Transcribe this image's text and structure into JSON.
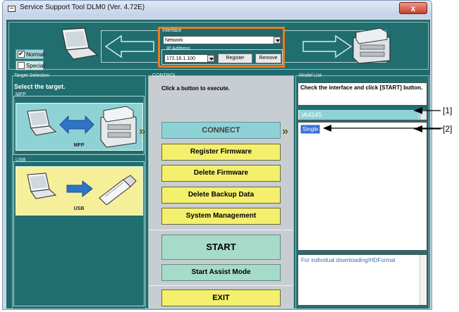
{
  "window": {
    "title": "Service Support Tool DLM0 (Ver. 4.72E)",
    "close_label": "x"
  },
  "mode": {
    "normal_label": "Normal",
    "special_label": "Special",
    "normal_checked": true,
    "special_checked": false
  },
  "interface": {
    "legend": "Interface",
    "selected": "Network",
    "ip_legend": "IP Address",
    "ip_value": "172.16.1.100",
    "register_label": "Register",
    "remove_label": "Remove"
  },
  "target": {
    "legend": "Target Selection",
    "prompt": "Select the target.",
    "mfp_legend": "MFP",
    "mfp_caption": "MFP",
    "usb_legend": "USB",
    "usb_caption": "USB"
  },
  "control": {
    "legend": "CONTROL",
    "instruction": "Click a button to execute.",
    "connect_label": "CONNECT",
    "register_fw_label": "Register Firmware",
    "delete_fw_label": "Delete Firmware",
    "delete_backup_label": "Delete Backup Data",
    "system_mgmt_label": "System Management",
    "start_label": "START",
    "assist_label": "Start Assist Mode",
    "exit_label": "EXIT",
    "chevron": "»"
  },
  "model_list": {
    "legend": "Model List",
    "hint": "Check the interface and click [START] button.",
    "selected_model": "iA4245",
    "item": "Single",
    "note": "For individual downloading/HDFormat"
  },
  "callouts": {
    "one": "[1]",
    "two": "[2]"
  },
  "colors": {
    "panel": "#206e70",
    "interface_border": "#ef7a1e",
    "yellow_button": "#f4f06d",
    "connect": "#8fd2d6"
  }
}
